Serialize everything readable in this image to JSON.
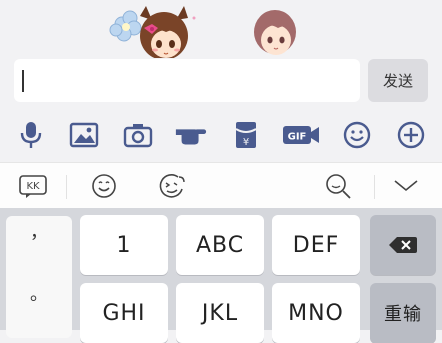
{
  "stickers": [
    {
      "name": "cat-girl-sticker"
    },
    {
      "name": "boy-sticker"
    }
  ],
  "input": {
    "value": "",
    "send_label": "发送"
  },
  "toolbar": {
    "items": [
      {
        "icon": "microphone-icon"
      },
      {
        "icon": "image-icon"
      },
      {
        "icon": "camera-icon"
      },
      {
        "icon": "poke-icon"
      },
      {
        "icon": "red-packet-icon"
      },
      {
        "icon": "gif-icon",
        "label": "GIF"
      },
      {
        "icon": "emoji-icon"
      },
      {
        "icon": "plus-icon"
      }
    ]
  },
  "ime": {
    "logo_label": "KK",
    "items": [
      {
        "icon": "smiley-icon"
      },
      {
        "icon": "emoji-face-icon"
      },
      {
        "icon": "search-icon"
      },
      {
        "icon": "collapse-icon"
      }
    ]
  },
  "keyboard": {
    "punctuation": [
      "，",
      "。"
    ],
    "keys": {
      "row1": [
        "1",
        "ABC",
        "DEF"
      ],
      "row2": [
        "GHI",
        "JKL",
        "MNO"
      ],
      "delete_icon": "backspace-icon",
      "reinput_label": "重输"
    }
  },
  "colors": {
    "accent": "#4b5a8c",
    "icon": "#4a5b8f",
    "keyboard_bg": "#d5d7dc"
  }
}
